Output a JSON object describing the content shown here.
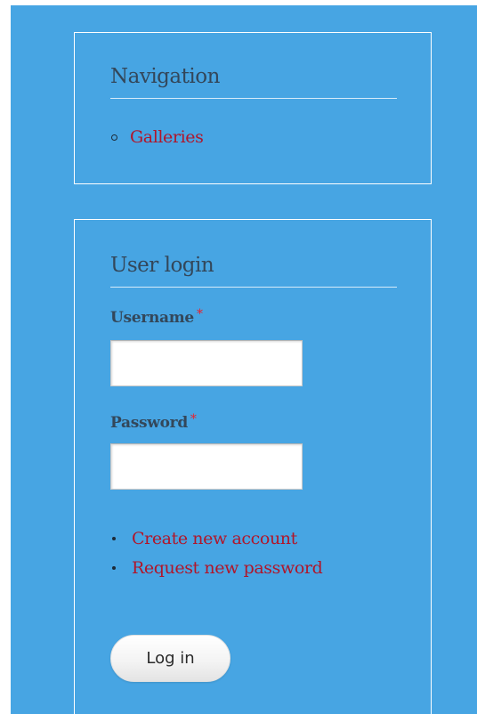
{
  "navigation": {
    "title": "Navigation",
    "items": [
      {
        "label": "Galleries"
      }
    ]
  },
  "user_login": {
    "title": "User login",
    "username": {
      "label": "Username",
      "required_marker": "*",
      "value": ""
    },
    "password": {
      "label": "Password",
      "required_marker": "*",
      "value": ""
    },
    "links": [
      {
        "label": "Create new account"
      },
      {
        "label": "Request new password"
      }
    ],
    "submit_label": "Log in"
  },
  "colors": {
    "sidebar_background": "#47a5e3",
    "block_border": "#ffffff",
    "link": "#b0162a",
    "heading": "#33475a",
    "required": "#e8222e"
  }
}
